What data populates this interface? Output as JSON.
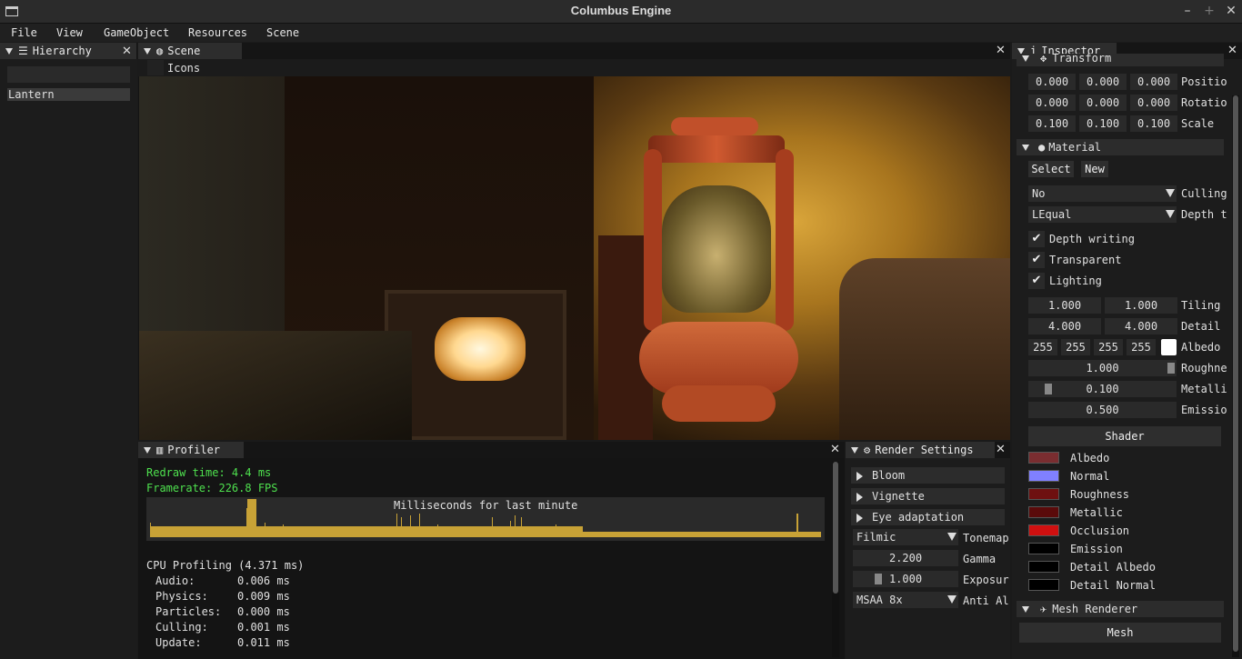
{
  "window": {
    "title": "Columbus Engine"
  },
  "menu": [
    "File",
    "View",
    "GameObject",
    "Resources",
    "Scene"
  ],
  "hierarchy": {
    "tab": "Hierarchy",
    "search": "",
    "items": [
      "Lantern"
    ]
  },
  "scene": {
    "tab": "Scene",
    "icons_label": "Icons"
  },
  "profiler": {
    "tab": "Profiler",
    "redraw": "Redraw time: 4.4 ms",
    "framerate": "Framerate:   226.8 FPS",
    "graph_title": "Milliseconds for last minute",
    "cpu_title": "CPU Profiling (4.371 ms)",
    "rows": [
      {
        "name": "Audio:",
        "value": "0.006 ms"
      },
      {
        "name": "Physics:",
        "value": "0.009 ms"
      },
      {
        "name": "Particles:",
        "value": "0.000 ms"
      },
      {
        "name": "Culling:",
        "value": "0.001 ms"
      },
      {
        "name": "Update:",
        "value": "0.011 ms"
      }
    ],
    "accent": "#c8a236"
  },
  "render_settings": {
    "tab": "Render Settings",
    "sections": [
      "Bloom",
      "Vignette",
      "Eye adaptation"
    ],
    "tonemap": {
      "value": "Filmic",
      "label": "Tonemap"
    },
    "gamma": {
      "value": "2.200",
      "label": "Gamma"
    },
    "exposure": {
      "value": "1.000",
      "label": "Exposur"
    },
    "aa": {
      "value": "MSAA 8x",
      "label": "Anti Al"
    }
  },
  "inspector": {
    "tab": "Inspector",
    "transform": {
      "header": "Transform",
      "rows": [
        {
          "values": [
            "0.000",
            "0.000",
            "0.000"
          ],
          "label": "Positio"
        },
        {
          "values": [
            "0.000",
            "0.000",
            "0.000"
          ],
          "label": "Rotatio"
        },
        {
          "values": [
            "0.100",
            "0.100",
            "0.100"
          ],
          "label": "Scale"
        }
      ]
    },
    "material": {
      "header": "Material",
      "select": "Select",
      "new": "New",
      "culling": {
        "value": "No",
        "label": "Culling"
      },
      "depth_test": {
        "value": "LEqual",
        "label": "Depth t"
      },
      "checks": [
        {
          "label": "Depth writing",
          "checked": true
        },
        {
          "label": "Transparent",
          "checked": true
        },
        {
          "label": "Lighting",
          "checked": true
        }
      ],
      "tiling": {
        "values": [
          "1.000",
          "1.000"
        ],
        "label": "Tiling"
      },
      "detail": {
        "values": [
          "4.000",
          "4.000"
        ],
        "label": "Detail"
      },
      "albedo": {
        "values": [
          "255",
          "255",
          "255",
          "255"
        ],
        "label": "Albedo",
        "color": "#ffffff"
      },
      "roughness": {
        "value": "1.000",
        "label": "Roughne",
        "level": 1.0
      },
      "metallic": {
        "value": "0.100",
        "label": "Metalli",
        "level": 0.1
      },
      "emission": {
        "value": "0.500",
        "label": "Emissio"
      },
      "shader": "Shader",
      "textures": [
        {
          "label": "Albedo",
          "color": "#7a2d30"
        },
        {
          "label": "Normal",
          "color": "#8080ff"
        },
        {
          "label": "Roughness",
          "color": "#6e1010"
        },
        {
          "label": "Metallic",
          "color": "#5a0a0a"
        },
        {
          "label": "Occlusion",
          "color": "#d01010"
        },
        {
          "label": "Emission",
          "color": "#000000"
        },
        {
          "label": "Detail Albedo",
          "color": "#000000"
        },
        {
          "label": "Detail Normal",
          "color": "#000000"
        }
      ]
    },
    "mesh_renderer": {
      "header": "Mesh Renderer",
      "mesh": "Mesh"
    }
  }
}
